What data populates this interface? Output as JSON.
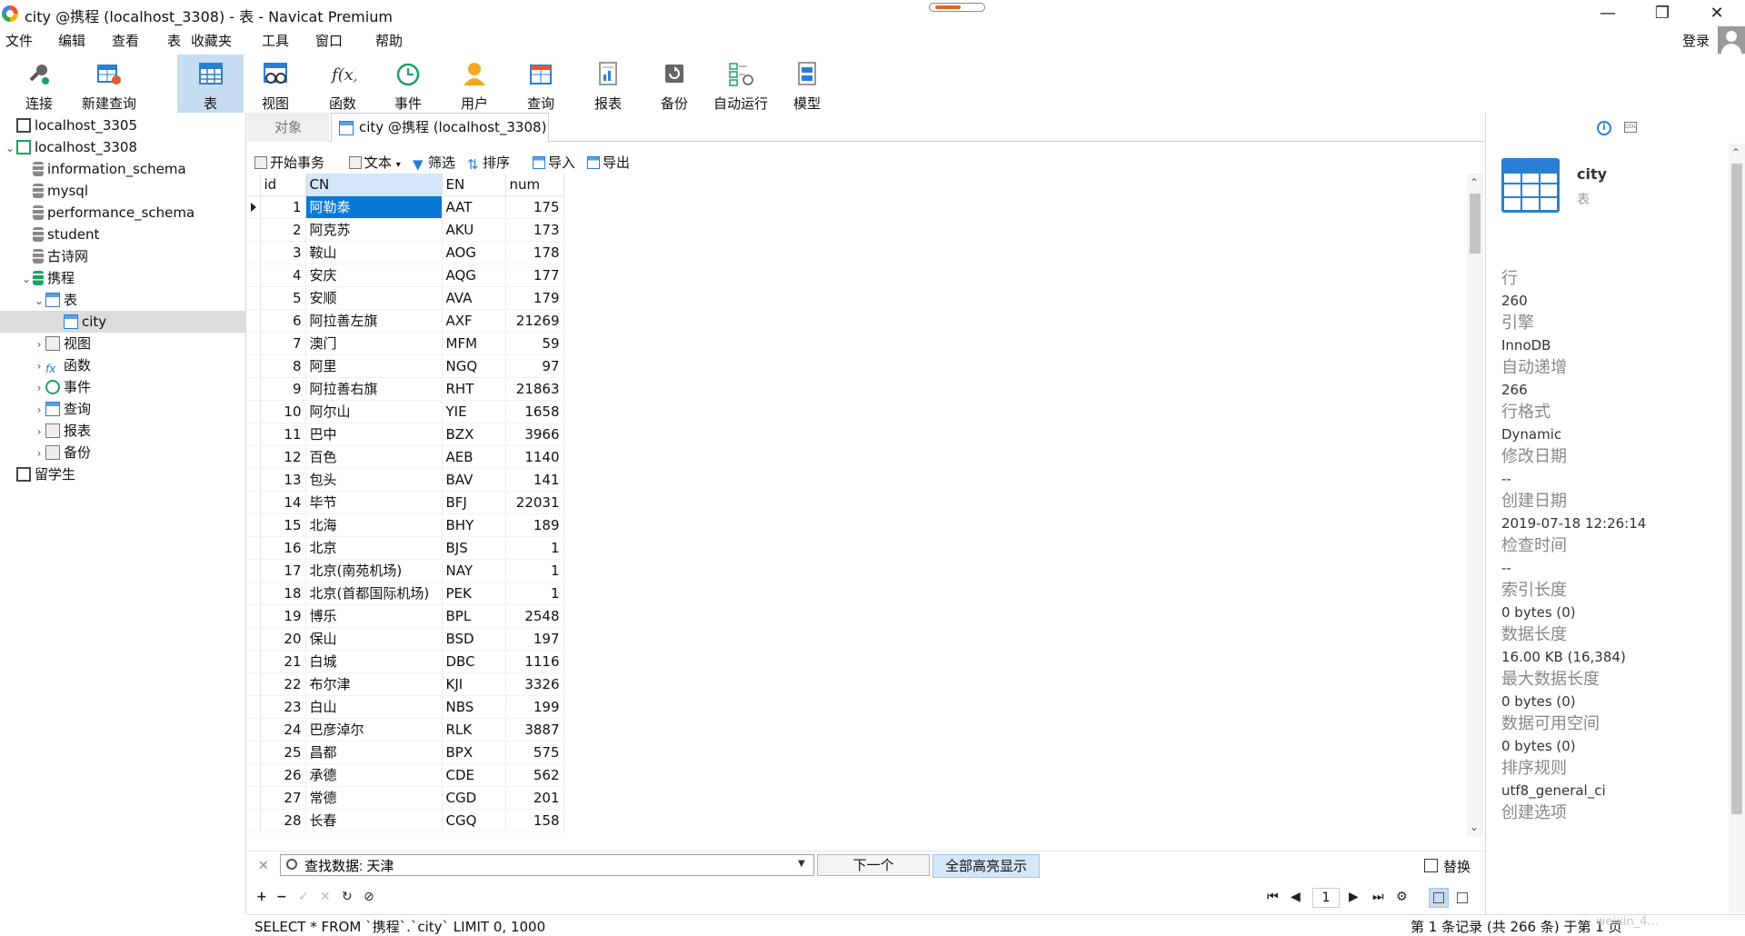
{
  "window": {
    "title": "city @携程 (localhost_3308) - 表 - Navicat Premium",
    "minimize": "—",
    "maximize": "❐",
    "close": "✕"
  },
  "menu": [
    "文件",
    "编辑",
    "查看",
    "表",
    "收藏夹",
    "工具",
    "窗口",
    "帮助"
  ],
  "login_label": "登录",
  "toolbar": [
    {
      "label": "连接",
      "icon": "connect-icon"
    },
    {
      "label": "新建查询",
      "icon": "new-query-icon"
    },
    {
      "label": "表",
      "icon": "table-icon",
      "active": true
    },
    {
      "label": "视图",
      "icon": "view-icon"
    },
    {
      "label": "函数",
      "icon": "function-icon"
    },
    {
      "label": "事件",
      "icon": "event-icon"
    },
    {
      "label": "用户",
      "icon": "user-icon"
    },
    {
      "label": "查询",
      "icon": "query-icon"
    },
    {
      "label": "报表",
      "icon": "report-icon"
    },
    {
      "label": "备份",
      "icon": "backup-icon"
    },
    {
      "label": "自动运行",
      "icon": "automation-icon"
    },
    {
      "label": "模型",
      "icon": "model-icon"
    }
  ],
  "sidebar": {
    "items": [
      {
        "label": "localhost_3305",
        "icon": "server-icon",
        "expanded": false
      },
      {
        "label": "localhost_3308",
        "icon": "server-icon",
        "expanded": true
      },
      {
        "label": "information_schema",
        "icon": "database-icon"
      },
      {
        "label": "mysql",
        "icon": "database-icon"
      },
      {
        "label": "performance_schema",
        "icon": "database-icon"
      },
      {
        "label": "student",
        "icon": "database-icon"
      },
      {
        "label": "古诗网",
        "icon": "database-icon"
      },
      {
        "label": "携程",
        "icon": "database-icon",
        "expanded": true
      },
      {
        "label": "表",
        "icon": "tables-folder-icon",
        "expanded": true
      },
      {
        "label": "city",
        "icon": "table-icon",
        "selected": true
      },
      {
        "label": "视图",
        "icon": "views-folder-icon"
      },
      {
        "label": "函数",
        "icon": "functions-folder-icon"
      },
      {
        "label": "事件",
        "icon": "events-folder-icon"
      },
      {
        "label": "查询",
        "icon": "queries-folder-icon"
      },
      {
        "label": "报表",
        "icon": "reports-folder-icon"
      },
      {
        "label": "备份",
        "icon": "backups-folder-icon"
      },
      {
        "label": "留学生",
        "icon": "server-icon"
      }
    ]
  },
  "tabs": {
    "objects": "对象",
    "active": "city @携程 (localhost_3308) ..."
  },
  "subtoolbar": {
    "begin_transaction": "开始事务",
    "text": "文本",
    "filter": "筛选",
    "sort": "排序",
    "import": "导入",
    "export": "导出"
  },
  "grid": {
    "columns": [
      "id",
      "CN",
      "EN",
      "num"
    ],
    "rows": [
      [
        "1",
        "阿勒泰",
        "AAT",
        "175"
      ],
      [
        "2",
        "阿克苏",
        "AKU",
        "173"
      ],
      [
        "3",
        "鞍山",
        "AOG",
        "178"
      ],
      [
        "4",
        "安庆",
        "AQG",
        "177"
      ],
      [
        "5",
        "安顺",
        "AVA",
        "179"
      ],
      [
        "6",
        "阿拉善左旗",
        "AXF",
        "21269"
      ],
      [
        "7",
        "澳门",
        "MFM",
        "59"
      ],
      [
        "8",
        "阿里",
        "NGQ",
        "97"
      ],
      [
        "9",
        "阿拉善右旗",
        "RHT",
        "21863"
      ],
      [
        "10",
        "阿尔山",
        "YIE",
        "1658"
      ],
      [
        "11",
        "巴中",
        "BZX",
        "3966"
      ],
      [
        "12",
        "百色",
        "AEB",
        "1140"
      ],
      [
        "13",
        "包头",
        "BAV",
        "141"
      ],
      [
        "14",
        "毕节",
        "BFJ",
        "22031"
      ],
      [
        "15",
        "北海",
        "BHY",
        "189"
      ],
      [
        "16",
        "北京",
        "BJS",
        "1"
      ],
      [
        "17",
        "北京(南苑机场)",
        "NAY",
        "1"
      ],
      [
        "18",
        "北京(首都国际机场)",
        "PEK",
        "1"
      ],
      [
        "19",
        "博乐",
        "BPL",
        "2548"
      ],
      [
        "20",
        "保山",
        "BSD",
        "197"
      ],
      [
        "21",
        "白城",
        "DBC",
        "1116"
      ],
      [
        "22",
        "布尔津",
        "KJI",
        "3326"
      ],
      [
        "23",
        "白山",
        "NBS",
        "199"
      ],
      [
        "24",
        "巴彦淖尔",
        "RLK",
        "3887"
      ],
      [
        "25",
        "昌都",
        "BPX",
        "575"
      ],
      [
        "26",
        "承德",
        "CDE",
        "562"
      ],
      [
        "27",
        "常德",
        "CGD",
        "201"
      ],
      [
        "28",
        "长春",
        "CGQ",
        "158"
      ]
    ]
  },
  "find": {
    "value": "查找数据: 天津",
    "next": "下一个",
    "highlight_all": "全部高亮显示",
    "replace": "替换"
  },
  "nav": {
    "page": "1"
  },
  "status": {
    "sql": "SELECT * FROM `携程`.`city` LIMIT 0, 1000",
    "records": "第 1 条记录 (共 266 条) 于第 1 页"
  },
  "info": {
    "name": "city",
    "type": "表",
    "props": [
      {
        "label": "行",
        "value": "260"
      },
      {
        "label": "引擎",
        "value": "InnoDB"
      },
      {
        "label": "自动递增",
        "value": "266"
      },
      {
        "label": "行格式",
        "value": "Dynamic"
      },
      {
        "label": "修改日期",
        "value": "--"
      },
      {
        "label": "创建日期",
        "value": "2019-07-18 12:26:14"
      },
      {
        "label": "检查时间",
        "value": "--"
      },
      {
        "label": "索引长度",
        "value": "0 bytes (0)"
      },
      {
        "label": "数据长度",
        "value": "16.00 KB (16,384)"
      },
      {
        "label": "最大数据长度",
        "value": "0 bytes (0)"
      },
      {
        "label": "数据可用空间",
        "value": "0 bytes (0)"
      },
      {
        "label": "排序规则",
        "value": "utf8_general_ci"
      },
      {
        "label": "创建选项",
        "value": ""
      }
    ]
  },
  "watermark": "weixin_4..."
}
